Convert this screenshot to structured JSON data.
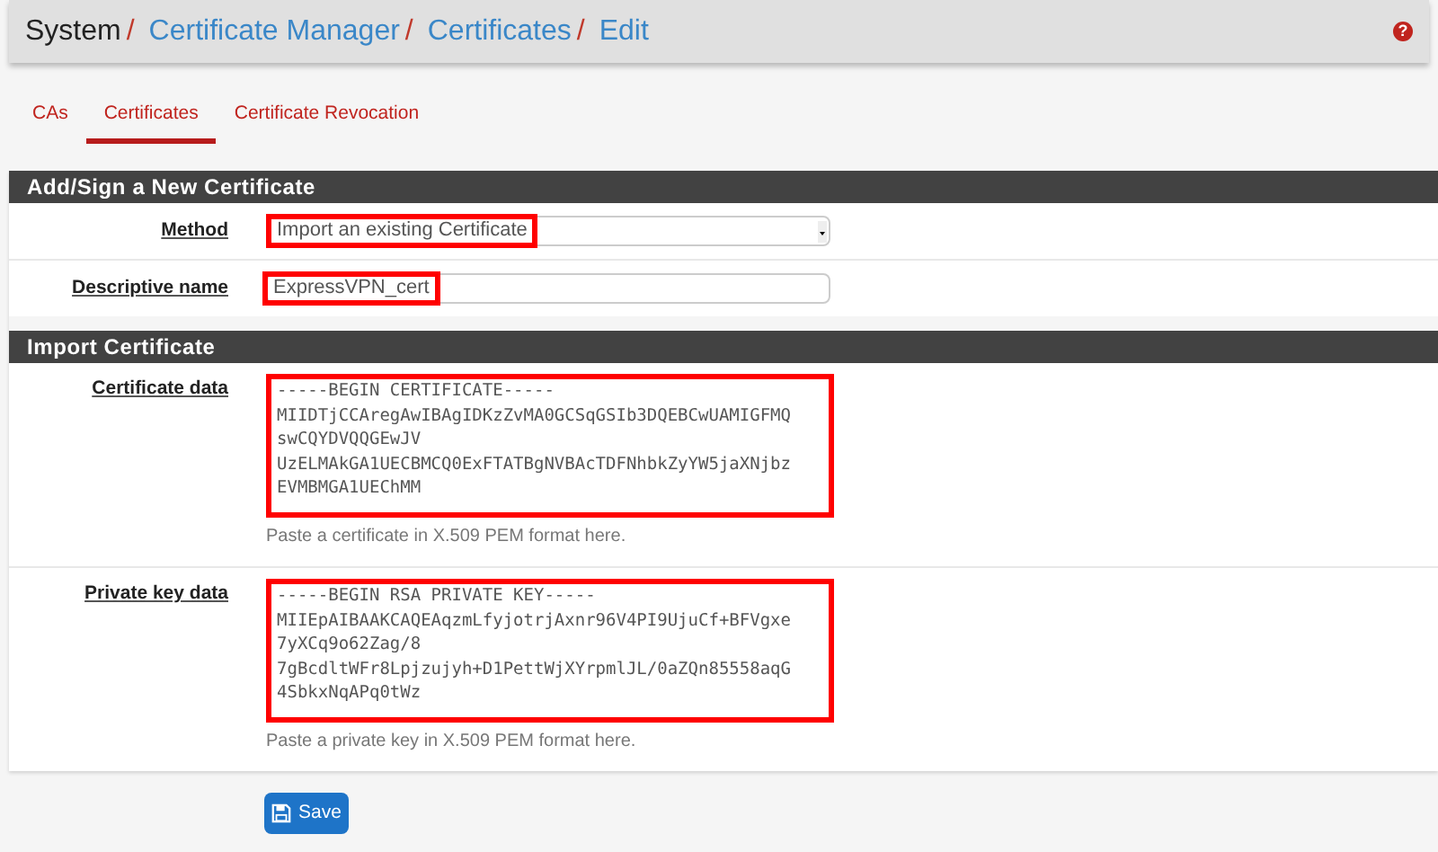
{
  "breadcrumb": [
    {
      "label": "System",
      "link": false
    },
    {
      "label": "Certificate Manager",
      "link": true
    },
    {
      "label": "Certificates",
      "link": true
    },
    {
      "label": "Edit",
      "link": true
    }
  ],
  "separator": "/",
  "help_glyph": "?",
  "tabs": [
    {
      "label": "CAs",
      "selected": false
    },
    {
      "label": "Certificates",
      "selected": true
    },
    {
      "label": "Certificate Revocation",
      "selected": false
    }
  ],
  "sections": [
    {
      "title": "Add/Sign a New Certificate",
      "rows": [
        {
          "kind": "select",
          "label": "Method",
          "value": "Import an existing Certificate",
          "highlighted": true
        },
        {
          "kind": "text",
          "label": "Descriptive name",
          "value": "ExpressVPN_cert",
          "highlighted": true
        }
      ]
    },
    {
      "title": "Import Certificate",
      "rows": [
        {
          "kind": "textarea",
          "label": "Certificate data",
          "lines": [
            "-----BEGIN CERTIFICATE-----",
            "MIIDTjCCAregAwIBAgIDKzZvMA0GCSqGSIb3DQEBCwUAMIGFMQ",
            "swCQYDVQQGEwJV",
            "UzELMAkGA1UECBMCQ0ExFTATBgNVBAcTDFNhbkZyYW5jaXNjbz",
            "EVMBMGA1UEChMM"
          ],
          "help": "Paste a certificate in X.509 PEM format here.",
          "highlighted": true
        },
        {
          "kind": "textarea",
          "label": "Private key data",
          "lines": [
            "-----BEGIN RSA PRIVATE KEY-----",
            "MIIEpAIBAAKCAQEAqzmLfyjotrjAxnr96V4PI9UjuCf+BFVgxe",
            "7yXCq9o62Zag/8",
            "7gBcdltWFr8Lpjzujyh+D1PettWjXYrpmlJL/0aZQn85558aqG",
            "4SbkxNqAPq0tWz"
          ],
          "help": "Paste a private key in X.509 PEM format here.",
          "highlighted": true
        }
      ]
    }
  ],
  "save_button": "Save"
}
